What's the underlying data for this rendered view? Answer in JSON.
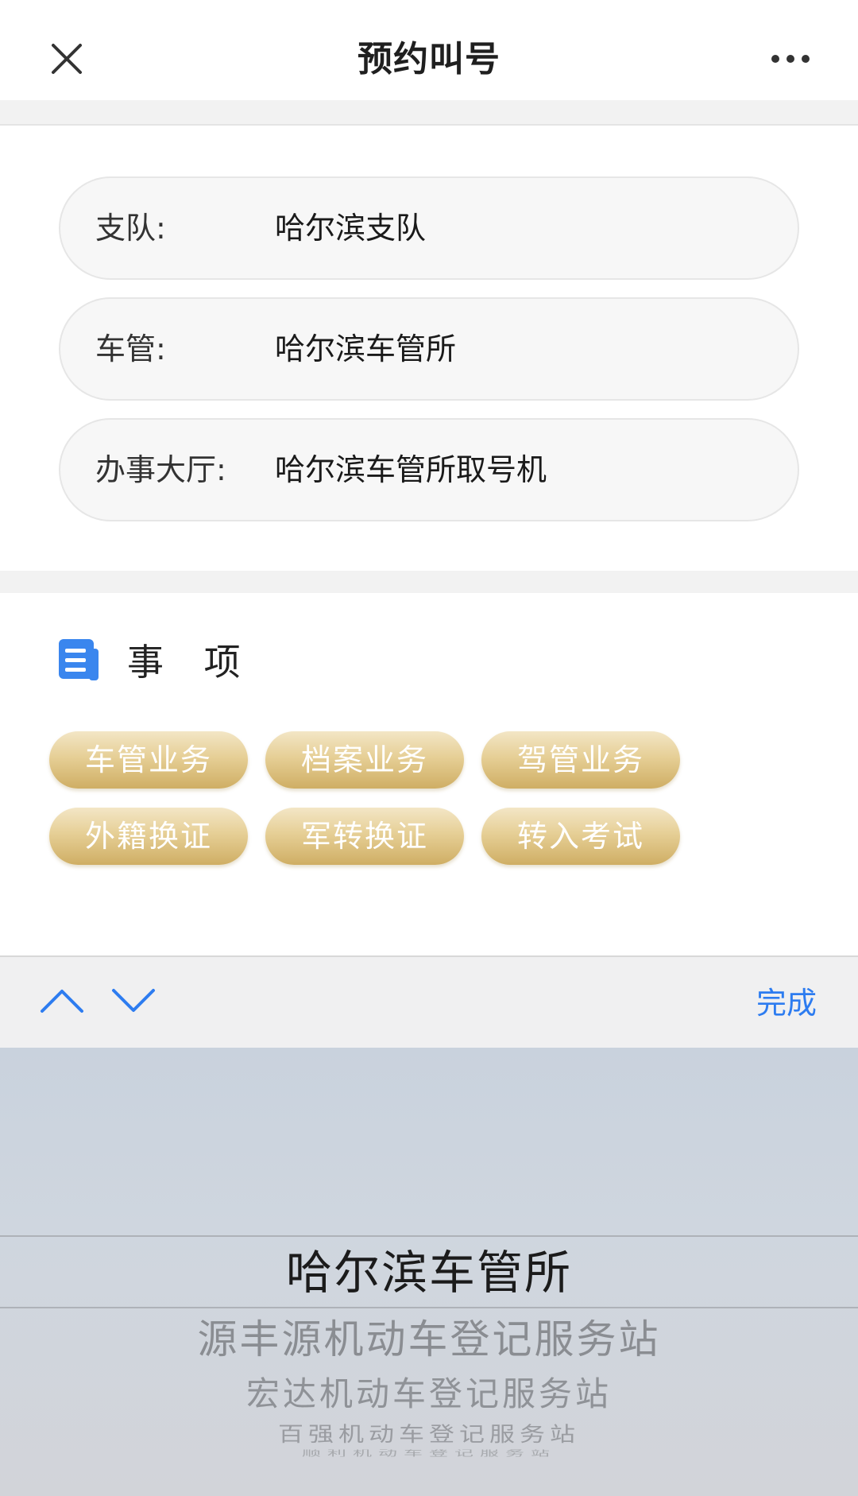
{
  "nav": {
    "title": "预约叫号",
    "close_icon": "close-icon",
    "more_icon": "more-icon"
  },
  "form": {
    "rows": [
      {
        "label": "支队:",
        "value": "哈尔滨支队"
      },
      {
        "label": "车管:",
        "value": "哈尔滨车管所"
      },
      {
        "label": "办事大厅:",
        "value": "哈尔滨车管所取号机"
      }
    ]
  },
  "matters": {
    "title": "事 项",
    "icon": "document-icon",
    "items": [
      "车管业务",
      "档案业务",
      "驾管业务",
      "外籍换证",
      "军转换证",
      "转入考试"
    ]
  },
  "toolbar": {
    "up_icon": "chevron-up-icon",
    "down_icon": "chevron-down-icon",
    "done_label": "完成"
  },
  "picker": {
    "selected": "哈尔滨车管所",
    "options": [
      "源丰源机动车登记服务站",
      "宏达机动车登记服务站",
      "百强机动车登记服务站",
      "顺利机动车登记服务站"
    ]
  },
  "colors": {
    "accent": "#2d7cf0",
    "chip_gold": "#d9bd7a",
    "icon_blue": "#3a86ee"
  }
}
